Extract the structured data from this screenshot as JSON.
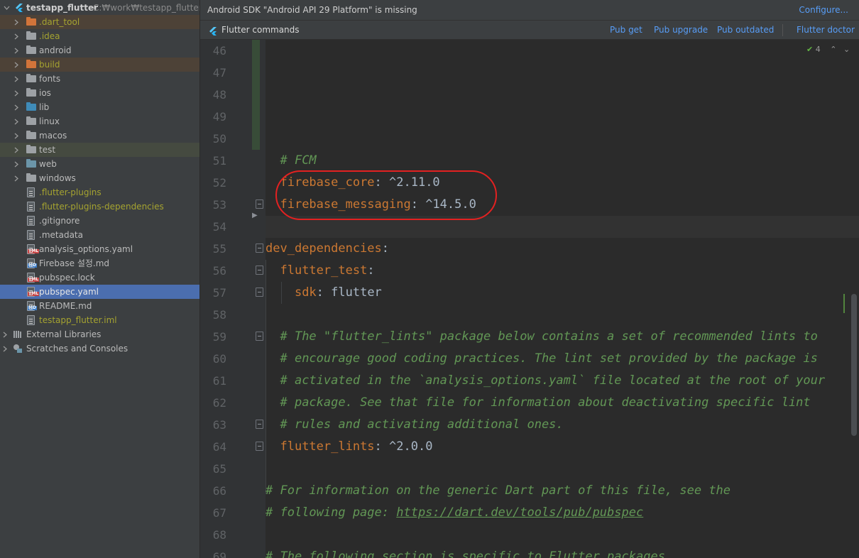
{
  "project": {
    "root_name": "testapp_flutter",
    "root_path": "C:₩work₩testapp_flutter",
    "items": [
      {
        "label": ".dart_tool",
        "kind": "folder-orange",
        "expandable": true
      },
      {
        "label": ".idea",
        "kind": "folder-grey",
        "expandable": true
      },
      {
        "label": "android",
        "kind": "folder-grey",
        "expandable": true
      },
      {
        "label": "build",
        "kind": "folder-orange",
        "expandable": true
      },
      {
        "label": "fonts",
        "kind": "folder-grey",
        "expandable": true
      },
      {
        "label": "ios",
        "kind": "folder-grey",
        "expandable": true
      },
      {
        "label": "lib",
        "kind": "folder-blue",
        "expandable": true
      },
      {
        "label": "linux",
        "kind": "folder-grey",
        "expandable": true
      },
      {
        "label": "macos",
        "kind": "folder-grey",
        "expandable": true
      },
      {
        "label": "test",
        "kind": "folder-grey",
        "expandable": true
      },
      {
        "label": "web",
        "kind": "folder-teal",
        "expandable": true
      },
      {
        "label": "windows",
        "kind": "folder-grey",
        "expandable": true
      },
      {
        "label": ".flutter-plugins",
        "kind": "file"
      },
      {
        "label": ".flutter-plugins-dependencies",
        "kind": "file"
      },
      {
        "label": ".gitignore",
        "kind": "file"
      },
      {
        "label": ".metadata",
        "kind": "file"
      },
      {
        "label": "analysis_options.yaml",
        "kind": "yml"
      },
      {
        "label": "Firebase 설정.md",
        "kind": "md"
      },
      {
        "label": "pubspec.lock",
        "kind": "yml"
      },
      {
        "label": "pubspec.yaml",
        "kind": "yml"
      },
      {
        "label": "README.md",
        "kind": "md"
      },
      {
        "label": "testapp_flutter.iml",
        "kind": "file"
      }
    ],
    "external_libraries": "External Libraries",
    "scratches": "Scratches and Consoles"
  },
  "notice": {
    "message": "Android SDK \"Android API 29 Platform\" is missing",
    "action": "Configure..."
  },
  "flutter_bar": {
    "title": "Flutter commands",
    "pub_get": "Pub get",
    "pub_upgrade": "Pub upgrade",
    "pub_outdated": "Pub outdated",
    "flutter_doctor": "Flutter doctor"
  },
  "inspections": {
    "count": "4"
  },
  "editor": {
    "line_numbers": [
      "46",
      "47",
      "48",
      "49",
      "50",
      "51",
      "52",
      "53",
      "54",
      "55",
      "56",
      "57",
      "58",
      "59",
      "60",
      "61",
      "62",
      "63",
      "64",
      "65",
      "66",
      "67",
      "68",
      "69"
    ],
    "lines": {
      "l51": "# FCM",
      "l52_key": "firebase_core",
      "l52_val": ": ^2.11.0",
      "l53_key": "firebase_messaging",
      "l53_val": ": ^14.5.0",
      "l55_key": "dev_dependencies",
      "l55_val": ":",
      "l56_key": "flutter_test",
      "l56_val": ":",
      "l57_key": "sdk",
      "l57_val": ": flutter",
      "l59": "# The \"flutter_lints\" package below contains a set of recommended lints to",
      "l60": "# encourage good coding practices. The lint set provided by the package is",
      "l61": "# activated in the `analysis_options.yaml` file located at the root of your",
      "l62": "# package. See that file for information about deactivating specific lint",
      "l63": "# rules and activating additional ones.",
      "l64_key": "flutter_lints",
      "l64_val": ": ^2.0.0",
      "l66": "# For information on the generic Dart part of this file, see the",
      "l67_pre": "# following page: ",
      "l67_link": "https://dart.dev/tools/pub/pubspec",
      "l69": "# The following section is specific to Flutter packages."
    }
  },
  "colors": {
    "tree_bg": "#3c3f41",
    "editor_bg": "#2b2b2b",
    "selection": "#4b6eaf",
    "link": "#589df6",
    "keyword": "#cc7832",
    "comment": "#629755",
    "annotation_circle": "#e32121"
  }
}
